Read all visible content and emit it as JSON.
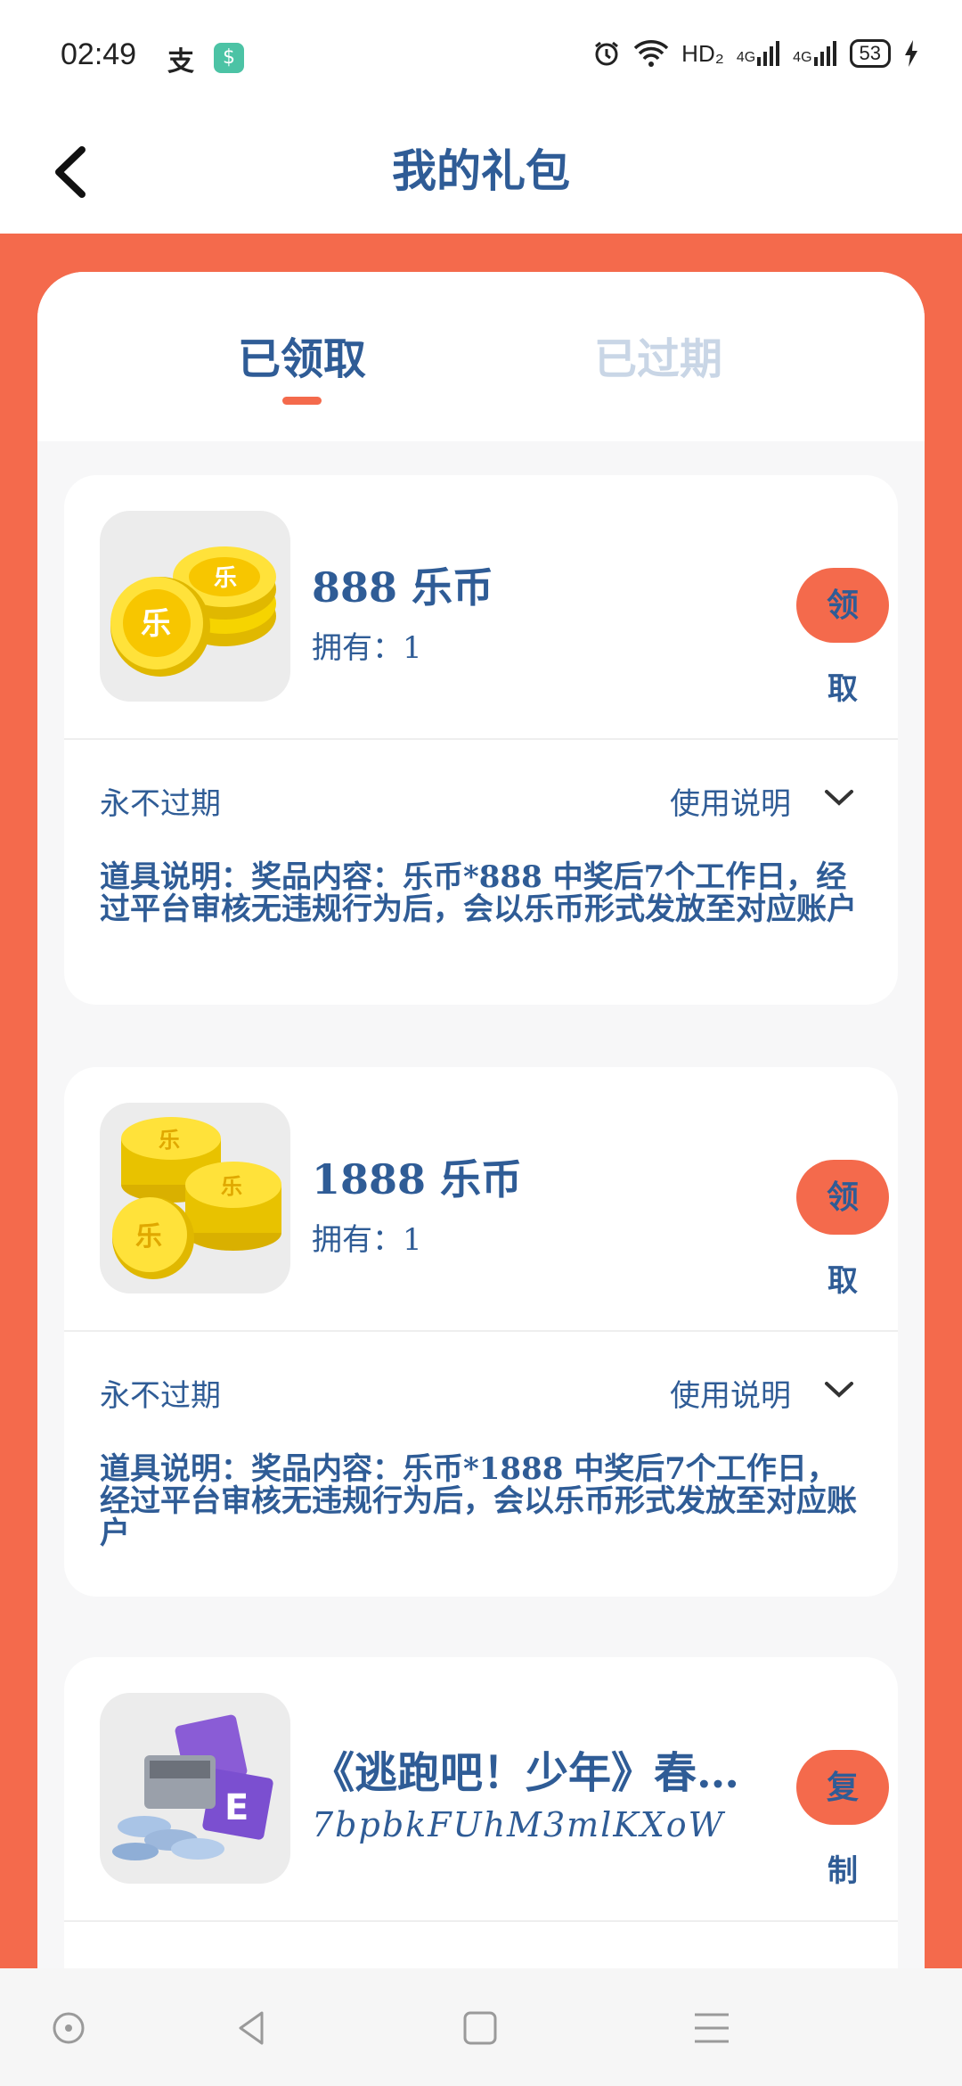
{
  "status_bar": {
    "time": "02:49",
    "alipay_glyph": "支",
    "app_badge": "$",
    "hd_label": "HD₂",
    "net1": "4G",
    "net2": "4G",
    "battery": "53"
  },
  "header": {
    "title": "我的礼包",
    "back_icon": "chevron-left-icon"
  },
  "tabs": [
    {
      "label": "已领取",
      "active": true
    },
    {
      "label": "已过期",
      "active": false
    }
  ],
  "cards": [
    {
      "title": "888 乐币",
      "subtitle": "拥有：1",
      "button_top": "领",
      "button_bottom": "取",
      "expiry": "永不过期",
      "usage_label": "使用说明",
      "description": "道具说明：奖品内容：乐币*888 中奖后7个工作日，经过平台审核无违规行为后，会以乐币形式发放至对应账户",
      "image": "coins-icon"
    },
    {
      "title": "1888 乐币",
      "subtitle": "拥有：1",
      "button_top": "领",
      "button_bottom": "取",
      "expiry": "永不过期",
      "usage_label": "使用说明",
      "description": "道具说明：奖品内容：乐币*1888 中奖后7个工作日，经过平台审核无违规行为后，会以乐币形式发放至对应账户",
      "image": "coins-stack-icon"
    },
    {
      "title": "《逃跑吧！少年》春…",
      "code": "7bpbkFUhM3mlKXoW",
      "button_top": "复",
      "button_bottom": "制",
      "image": "gift-box-icon"
    }
  ],
  "colors": {
    "accent": "#f46a4c",
    "text": "#2f5c96",
    "tab_inactive": "#c9d6e6"
  }
}
